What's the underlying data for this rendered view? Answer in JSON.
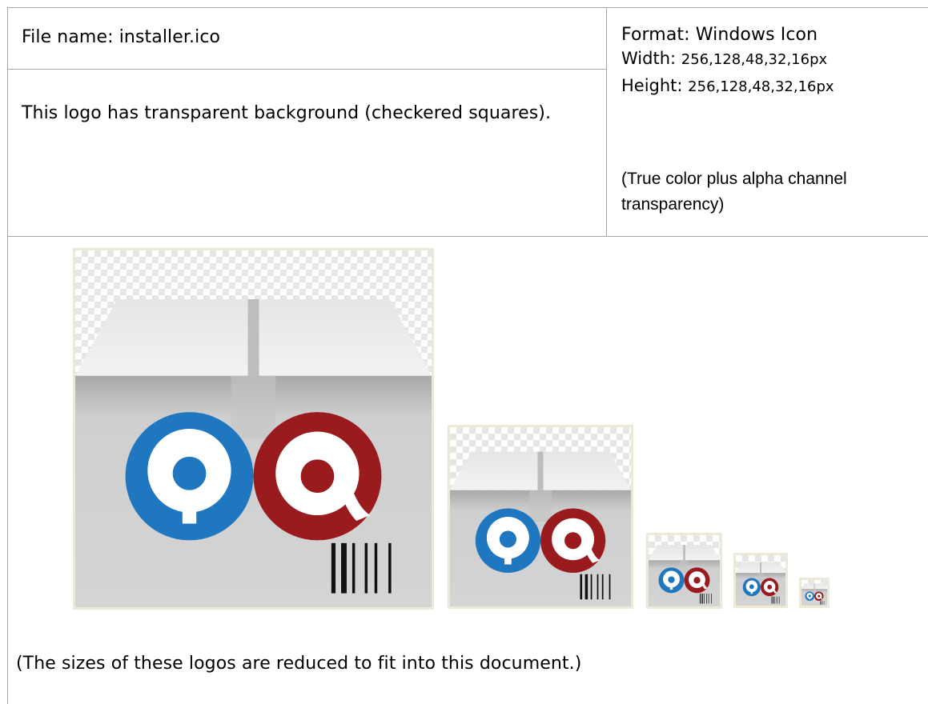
{
  "info": {
    "file_name": "File name: installer.ico",
    "background_note": "This logo has transparent background (checkered squares).",
    "format": "Format: Windows Icon",
    "width_label": "Width: ",
    "width_value": "256,128,48,32,16px",
    "height_label": "Height: ",
    "height_value": "256,128,48,32,16px",
    "transparency_note": "(True color plus alpha channel transparency)"
  },
  "preview": {
    "icon_sizes": [
      "256px",
      "128px",
      "48px",
      "32px",
      "16px"
    ],
    "footnote": "(The sizes of these logos are reduced to fit into this document.)"
  },
  "colors": {
    "logo_blue": "#1f77bf",
    "logo_red": "#9a1b1e",
    "box_grey": "#d3d3d3",
    "frame": "#ece9d8"
  }
}
